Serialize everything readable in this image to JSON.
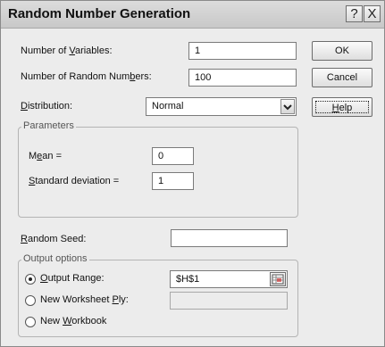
{
  "dialog": {
    "title": "Random Number Generation",
    "help_button": "?",
    "close_button": "X"
  },
  "fields": {
    "num_variables": {
      "label_pre": "Number of ",
      "label_u": "V",
      "label_post": "ariables:",
      "value": "1"
    },
    "num_random": {
      "label_pre": "Number of Random Num",
      "label_u": "b",
      "label_post": "ers:",
      "value": "100"
    },
    "distribution": {
      "label_pre": "",
      "label_u": "D",
      "label_post": "istribution:",
      "value": "Normal"
    }
  },
  "buttons": {
    "ok": "OK",
    "cancel": "Cancel",
    "help_u": "H",
    "help_rest": "elp"
  },
  "parameters": {
    "legend": "Parameters",
    "mean": {
      "label_pre": "M",
      "label_u": "e",
      "label_post": "an =",
      "value": "0"
    },
    "std": {
      "label_pre": "",
      "label_u": "S",
      "label_post": "tandard deviation =",
      "value": "1"
    }
  },
  "seed": {
    "label_pre": "",
    "label_u": "R",
    "label_post": "andom Seed:",
    "value": ""
  },
  "output": {
    "legend": "Output options",
    "output_range": {
      "label_pre": "",
      "label_u": "O",
      "label_post": "utput Range:",
      "value": "$H$1",
      "selected": true
    },
    "new_ply": {
      "label_pre": "New Worksheet ",
      "label_u": "P",
      "label_post": "ly:",
      "value": ""
    },
    "new_workbook": {
      "label_pre": "New ",
      "label_u": "W",
      "label_post": "orkbook"
    }
  }
}
